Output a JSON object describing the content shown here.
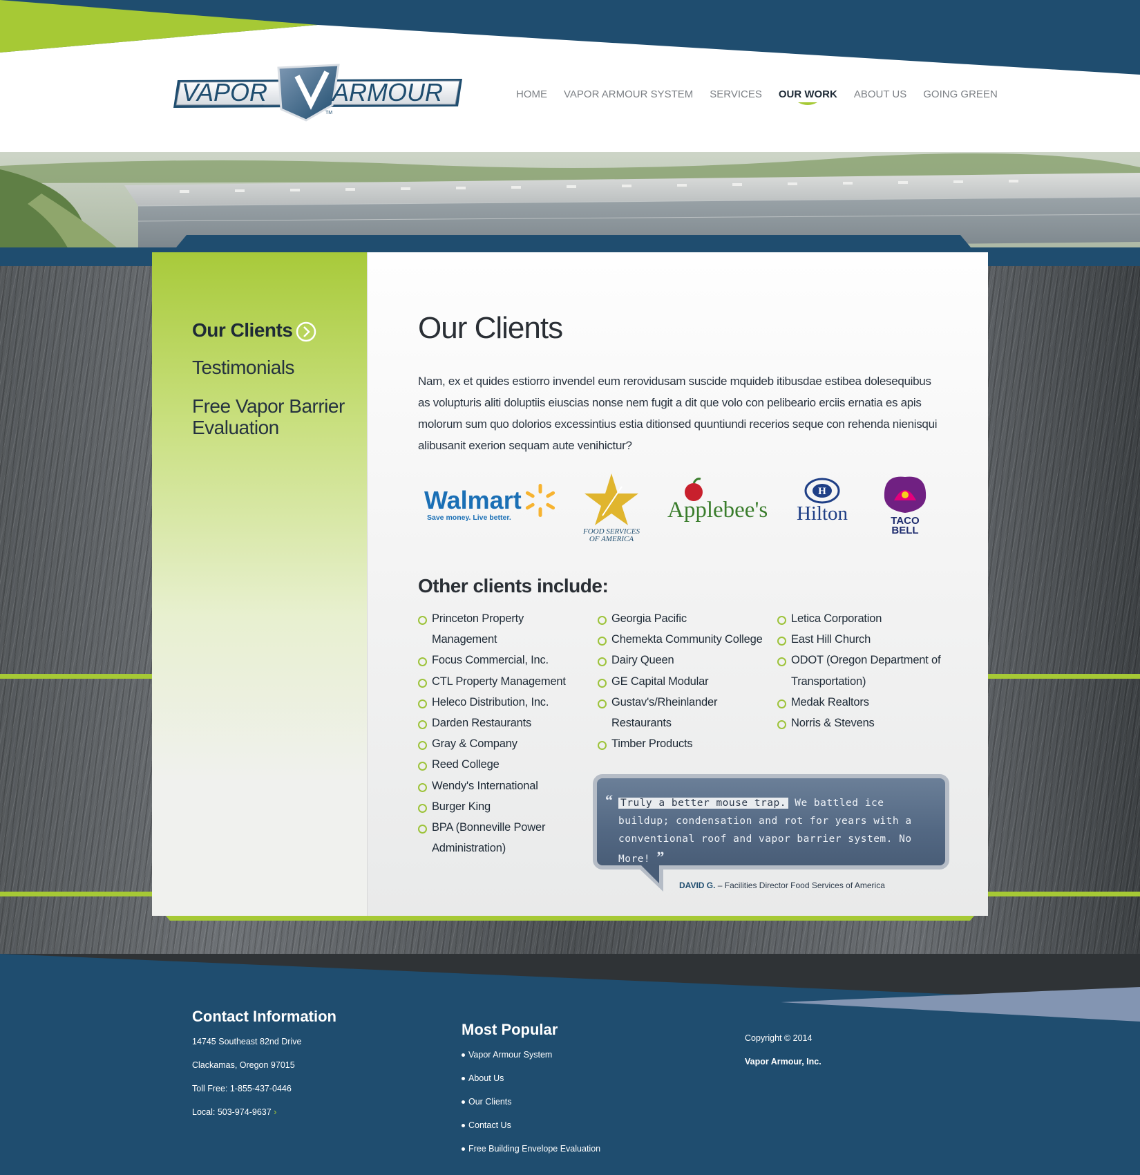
{
  "brand": {
    "logo_left": "VAPOR",
    "logo_right": "ARMOUR",
    "logo_tm": "TM"
  },
  "nav": {
    "items": [
      "HOME",
      "VAPOR ARMOUR SYSTEM",
      "SERVICES",
      "OUR WORK",
      "ABOUT US",
      "GOING GREEN"
    ],
    "active": "OUR WORK"
  },
  "sidebar": {
    "items": [
      "Our Clients",
      "Testimonials",
      "Free Vapor Barrier Evaluation"
    ]
  },
  "content": {
    "title": "Our Clients",
    "intro": "Nam, ex et quides estiorro invendel eum rerovidusam suscide mquideb itibusdae estibea dolesequibus as volupturis aliti doluptiis eiuscias nonse nem fugit a dit que volo con pelibeario erciis ernatia es apis molorum sum quo dolorios excessintius estia ditionsed quuntiundi recerios seque con rehenda nienisqui alibusanit exerion sequam aute venihictur?",
    "logos": {
      "walmart": {
        "name": "Walmart",
        "tagline": "Save money. Live better."
      },
      "fsa": {
        "line1": "FOOD SERVICES",
        "line2": "OF AMERICA"
      },
      "applebees": "Applebee's",
      "hilton": "Hilton",
      "tacobell": {
        "line1": "TACO",
        "line2": "BELL"
      }
    },
    "other_title": "Other clients include:",
    "clients_col1": [
      "Princeton Property Management",
      "Focus Commercial, Inc.",
      "CTL Property Management",
      "Heleco Distribution, Inc.",
      "Darden Restaurants",
      "Gray & Company",
      "Reed College",
      "Wendy's International",
      "Burger King",
      "BPA (Bonneville Power Administration)"
    ],
    "clients_col2": [
      "Georgia Pacific",
      "Chemekta Community College",
      "Dairy Queen",
      "GE Capital Modular",
      "Gustav's/Rheinlander Restaurants",
      "Timber Products"
    ],
    "clients_col3": [
      "Letica Corporation",
      "East Hill Church",
      "ODOT (Oregon Department of Transportation)",
      "Medak Realtors",
      "Norris & Stevens"
    ]
  },
  "quote": {
    "highlight": "Truly a better mouse trap.",
    "rest": " We battled ice buildup; condensation and rot for years with a conventional roof and vapor barrier system. No More!",
    "open_mark": "“",
    "close_mark": "”",
    "author": "DAVID G.",
    "role": " – Facilities Director Food Services of America"
  },
  "footer": {
    "contact": {
      "heading": "Contact Information",
      "address1": "14745 Southeast 82nd Drive",
      "address2": "Clackamas, Oregon 97015",
      "tollfree": "Toll Free: 1-855-437-0446",
      "local": "Local: 503-974-9637"
    },
    "popular": {
      "heading": "Most Popular",
      "links": [
        "Vapor Armour System",
        "About Us",
        "Our Clients",
        "Contact Us",
        "Free Building Envelope Evaluation"
      ]
    },
    "copyright": "Copyright © 2014",
    "company": "Vapor Armour, Inc."
  },
  "colors": {
    "navy": "#1f4d6f",
    "lime": "#a6c935",
    "dark_text": "#1e2a36"
  }
}
